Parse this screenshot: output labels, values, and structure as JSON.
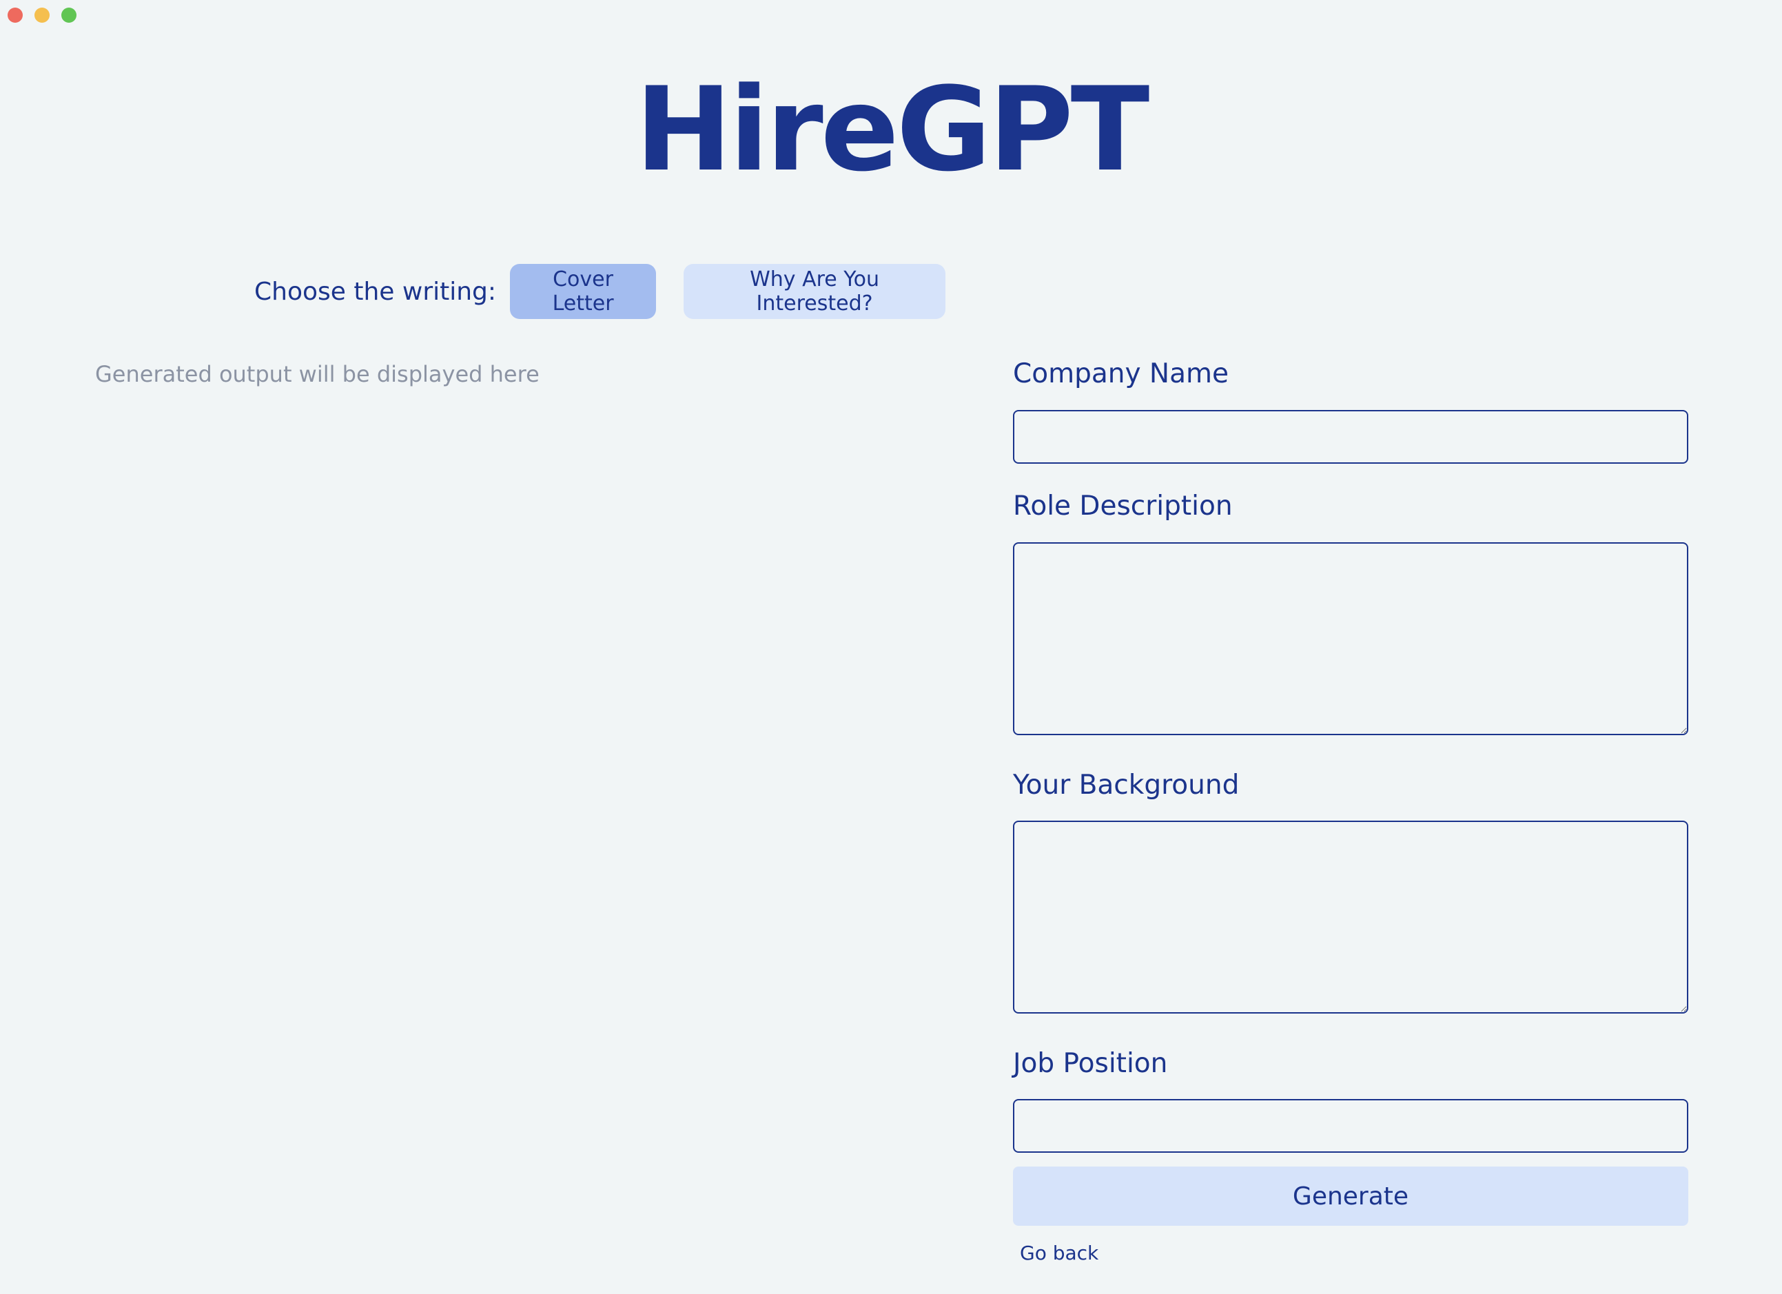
{
  "app": {
    "title": "HireGPT"
  },
  "mode_selector": {
    "label": "Choose the writing:",
    "options": [
      {
        "label": "Cover Letter",
        "active": true
      },
      {
        "label": "Why Are You Interested?",
        "active": false
      }
    ]
  },
  "output": {
    "placeholder": "Generated output will be displayed here"
  },
  "form": {
    "company_name": {
      "label": "Company Name",
      "value": ""
    },
    "role_description": {
      "label": "Role Description",
      "value": ""
    },
    "background": {
      "label": "Your Background",
      "value": ""
    },
    "job_position": {
      "label": "Job Position",
      "value": ""
    },
    "generate_label": "Generate",
    "go_back_label": "Go back"
  },
  "colors": {
    "primary_text": "#1b348c",
    "background": "#f1f5f6",
    "active_button": "#a3bcef",
    "inactive_button": "#d6e3fa",
    "placeholder_text": "#8b93a3"
  }
}
